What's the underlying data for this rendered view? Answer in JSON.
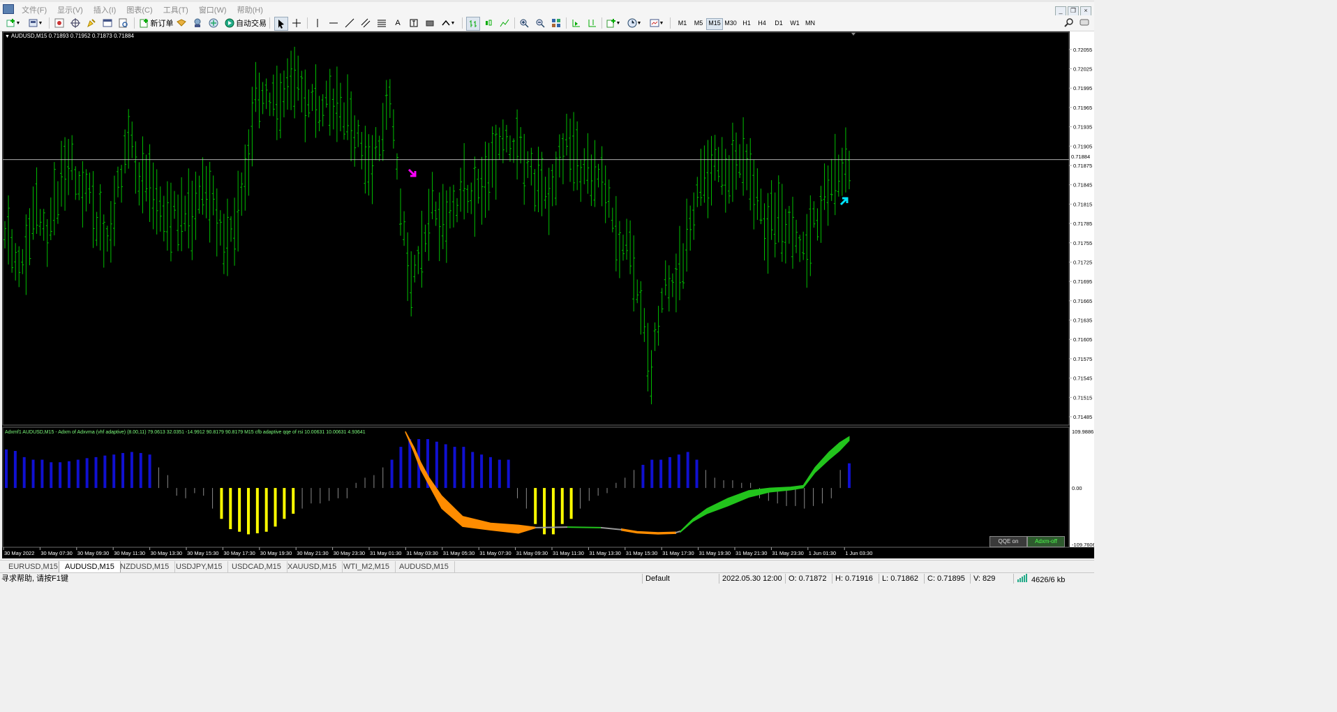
{
  "menu": [
    "文件(F)",
    "显示(V)",
    "插入(I)",
    "图表(C)",
    "工具(T)",
    "窗口(W)",
    "帮助(H)"
  ],
  "toolbar": {
    "new_order_label": "新订单",
    "auto_trade_label": "自动交易",
    "text_tool_label": "A",
    "timeframes": [
      "M1",
      "M5",
      "M15",
      "M30",
      "H1",
      "H4",
      "D1",
      "W1",
      "MN"
    ],
    "active_timeframe": "M15"
  },
  "chart": {
    "header": "AUDUSD,M15  0.71893 0.71952 0.71873 0.71884",
    "indicator_header": "Adxmf1 AUDUSD,M15 - Adxm of Adxvma (vhf adaptive) (8.00,11) 79.0613 32.0351 -14.9912 90.8179 90.8179   M15  cfb adaptive qqe of rsi 10.00631 10.00631 4.93641",
    "current_price": "0.71884",
    "price_ticks": [
      "0.72055",
      "0.72025",
      "0.71995",
      "0.71965",
      "0.71935",
      "0.71905",
      "0.71875",
      "0.71845",
      "0.71815",
      "0.71785",
      "0.71755",
      "0.71725",
      "0.71695",
      "0.71665",
      "0.71635",
      "0.71605",
      "0.71575",
      "0.71545",
      "0.71515",
      "0.71485"
    ],
    "indicator_ticks": [
      "109.9886",
      "0.00",
      "-109.7606"
    ],
    "time_ticks": [
      "30 May 2022",
      "30 May 07:30",
      "30 May 09:30",
      "30 May 11:30",
      "30 May 13:30",
      "30 May 15:30",
      "30 May 17:30",
      "30 May 19:30",
      "30 May 21:30",
      "30 May 23:30",
      "31 May 01:30",
      "31 May 03:30",
      "31 May 05:30",
      "31 May 07:30",
      "31 May 09:30",
      "31 May 11:30",
      "31 May 13:30",
      "31 May 15:30",
      "31 May 17:30",
      "31 May 19:30",
      "31 May 21:30",
      "31 May 23:30",
      "1 Jun 01:30",
      "1 Jun 03:30"
    ],
    "qqe_on_label": "QQE on",
    "adxm_off_label": "Adxm-off",
    "colors": {
      "background": "#000000",
      "bars": "#00c000",
      "sell_arrow": "#ff00ff",
      "buy_arrow": "#00ffff",
      "hist_up": "#1010d0",
      "hist_down": "#ffff00",
      "hist_neutral": "#8a8a8a",
      "qqe_down": "#ff8c00",
      "qqe_up": "#22c41c"
    }
  },
  "chart_data": [
    {
      "type": "line",
      "title": "AUDUSD,M15",
      "subtitle": "0.71893 0.71952 0.71873 0.71884",
      "ylim": [
        0.71485,
        0.7207
      ],
      "series": [
        {
          "values": [
            0.7178,
            0.7172,
            0.7175,
            0.7181,
            0.7175,
            0.7183,
            0.7188,
            0.7186,
            0.7183,
            0.7178,
            0.7176,
            0.7185,
            0.7191,
            0.7185,
            0.7183,
            0.718,
            0.718,
            0.7179,
            0.718,
            0.7185,
            0.7182,
            0.7177,
            0.7178,
            0.7184,
            0.7198,
            0.7198,
            0.7197,
            0.7199,
            0.72,
            0.7198,
            0.7197,
            0.7197,
            0.7196,
            0.7195,
            0.7191,
            0.7188,
            0.719,
            0.72,
            0.718,
            0.7168,
            0.7175,
            0.7182,
            0.7178,
            0.7181,
            0.7184,
            0.7183,
            0.7185,
            0.7188,
            0.7191,
            0.719,
            0.7188,
            0.7184,
            0.7182,
            0.7186,
            0.7192,
            0.7187,
            0.7186,
            0.7185,
            0.7182,
            0.7176,
            0.7174,
            0.7165,
            0.7155,
            0.7168,
            0.717,
            0.7172,
            0.718,
            0.7186,
            0.7188,
            0.7186,
            0.7188,
            0.719,
            0.7183,
            0.7178,
            0.718,
            0.7178,
            0.7175,
            0.7176,
            0.718,
            0.7184,
            0.7185,
            0.7188
          ]
        }
      ]
    },
    {
      "type": "bar",
      "title": "Adxmf1 AUDUSD,M15",
      "ylim": [
        -109.7606,
        109.9886
      ],
      "series": [
        {
          "values": [
            75,
            72,
            60,
            55,
            55,
            50,
            50,
            52,
            55,
            58,
            60,
            63,
            65,
            68,
            70,
            68,
            65,
            40,
            25,
            -15,
            -20,
            -10,
            -15,
            -40,
            -60,
            -80,
            -85,
            -90,
            -88,
            -85,
            -75,
            -60,
            -50,
            -40,
            -30,
            -30,
            -25,
            -20,
            -20,
            10,
            20,
            25,
            40,
            55,
            80,
            95,
            95,
            95,
            90,
            85,
            80,
            80,
            70,
            65,
            60,
            55,
            55,
            -20,
            -40,
            -70,
            -90,
            -90,
            -70,
            -60,
            -40,
            -25,
            -15,
            -10,
            10,
            20,
            35,
            45,
            55,
            55,
            60,
            65,
            70,
            55,
            35,
            20,
            15,
            15,
            10,
            10,
            -20,
            -25,
            -30,
            -35,
            -35,
            -40,
            -35,
            -30,
            -20,
            35,
            48
          ]
        }
      ]
    }
  ],
  "tabs": [
    "EURUSD,M15",
    "AUDUSD,M15",
    "NZDUSD,M15",
    "USDJPY,M15",
    "USDCAD,M15",
    "XAUUSD,M15",
    "WTI_M2,M15",
    "AUDUSD,M15"
  ],
  "active_tab": 1,
  "status": {
    "help": "寻求帮助, 请按F1键",
    "profile": "Default",
    "datetime": "2022.05.30 12:00",
    "open": "O: 0.71872",
    "high": "H: 0.71916",
    "low": "L: 0.71862",
    "close": "C: 0.71895",
    "volume": "V: 829",
    "traffic": "4626/6 kb"
  }
}
